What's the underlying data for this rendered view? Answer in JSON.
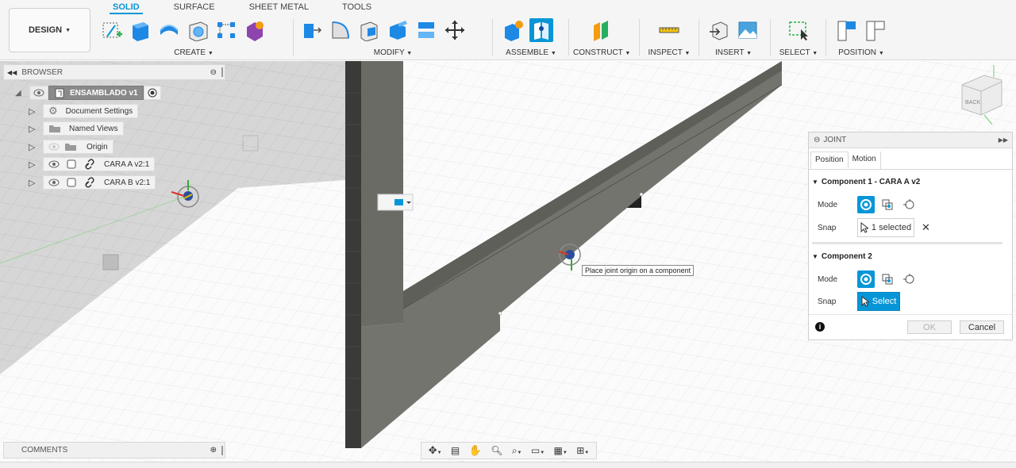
{
  "toolbar": {
    "design_label": "DESIGN",
    "tabs": [
      "SOLID",
      "SURFACE",
      "SHEET METAL",
      "TOOLS"
    ],
    "groups": {
      "create": "CREATE",
      "modify": "MODIFY",
      "assemble": "ASSEMBLE",
      "construct": "CONSTRUCT",
      "inspect": "INSPECT",
      "insert": "INSERT",
      "select": "SELECT",
      "position": "POSITION"
    }
  },
  "browser": {
    "title": "BROWSER",
    "root": "ENSAMBLADO v1",
    "items": [
      "Document Settings",
      "Named Views",
      "Origin",
      "CARA A v2:1",
      "CARA B v2:1"
    ]
  },
  "comments": {
    "title": "COMMENTS"
  },
  "viewcube": {
    "label": "BACK"
  },
  "tooltip": "Place joint origin on a component",
  "joint": {
    "title": "JOINT",
    "tabs": [
      "Position",
      "Motion"
    ],
    "component1": {
      "title": "Component 1 - CARA A v2",
      "mode_label": "Mode",
      "snap_label": "Snap",
      "snap_value": "1 selected"
    },
    "component2": {
      "title": "Component 2",
      "mode_label": "Mode",
      "snap_label": "Snap",
      "snap_value": "Select"
    },
    "ok": "OK",
    "cancel": "Cancel"
  },
  "colors": {
    "accent": "#0696d7",
    "model_face": "#6b6b65",
    "model_dark": "#3a3a38"
  }
}
